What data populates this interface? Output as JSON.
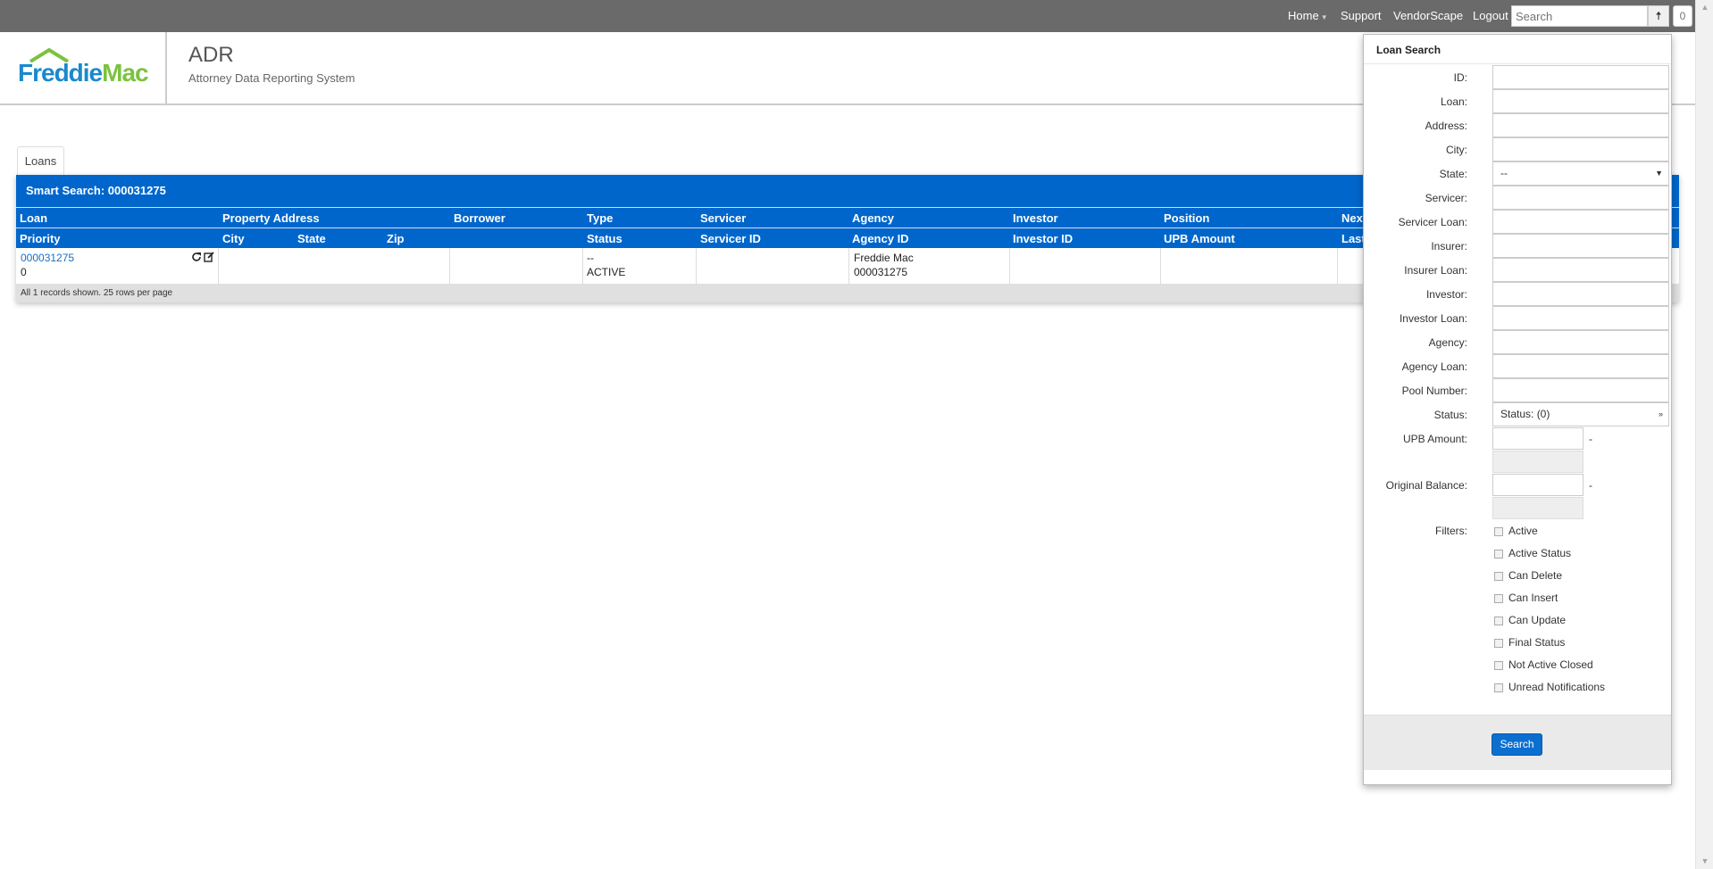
{
  "topnav": {
    "home": "Home",
    "support": "Support",
    "vendorscape": "VendorScape",
    "logout": "Logout",
    "search_placeholder": "Search",
    "badge_count": "0"
  },
  "header": {
    "logo_freddie": "Freddie",
    "logo_mac": "Mac",
    "app_title": "ADR",
    "app_subtitle": "Attorney Data Reporting System"
  },
  "tabs": [
    {
      "label": "Loans"
    }
  ],
  "grid": {
    "title": "Smart Search: 000031275",
    "header_row1": [
      "Loan",
      "Property Address",
      "Borrower",
      "Type",
      "Servicer",
      "Agency",
      "Investor",
      "Position",
      "Next"
    ],
    "header_row2": [
      "Priority",
      "City",
      "State",
      "Zip",
      "Status",
      "Servicer ID",
      "Agency ID",
      "Investor ID",
      "UPB Amount",
      "Last"
    ],
    "row": {
      "loan": "000031275",
      "priority": "0",
      "type": "--",
      "status": "ACTIVE",
      "agency": "Freddie Mac",
      "agency_id": "000031275"
    },
    "footer": "All 1 records shown. 25 rows per page"
  },
  "search_panel": {
    "title": "Loan Search",
    "fields": [
      {
        "label": "ID:"
      },
      {
        "label": "Loan:"
      },
      {
        "label": "Address:"
      },
      {
        "label": "City:"
      },
      {
        "label": "State:",
        "value": "--"
      },
      {
        "label": "Servicer:"
      },
      {
        "label": "Servicer Loan:"
      },
      {
        "label": "Insurer:"
      },
      {
        "label": "Insurer Loan:"
      },
      {
        "label": "Investor:"
      },
      {
        "label": "Investor Loan:"
      },
      {
        "label": "Agency:"
      },
      {
        "label": "Agency Loan:"
      },
      {
        "label": "Pool Number:"
      },
      {
        "label": "Status:",
        "value": "Status: (0)"
      }
    ],
    "upb_label": "UPB Amount:",
    "orig_label": "Original Balance:",
    "range_dash": "-",
    "filters_label": "Filters:",
    "filters": [
      "Active",
      "Active Status",
      "Can Delete",
      "Can Insert",
      "Can Update",
      "Final Status",
      "Not Active Closed",
      "Unread Notifications"
    ],
    "search_button": "Search"
  },
  "colors": {
    "topbar": "#6a6a6a",
    "grid_header": "#0066cc",
    "link": "#1a6fc1",
    "logo_blue": "#1b89cc",
    "logo_green": "#7cc23f",
    "button": "#0b6fd0"
  },
  "icons": [
    "arrow-up-icon",
    "refresh-icon",
    "edit-icon",
    "chevron-down-icon",
    "caret-down-icon"
  ]
}
